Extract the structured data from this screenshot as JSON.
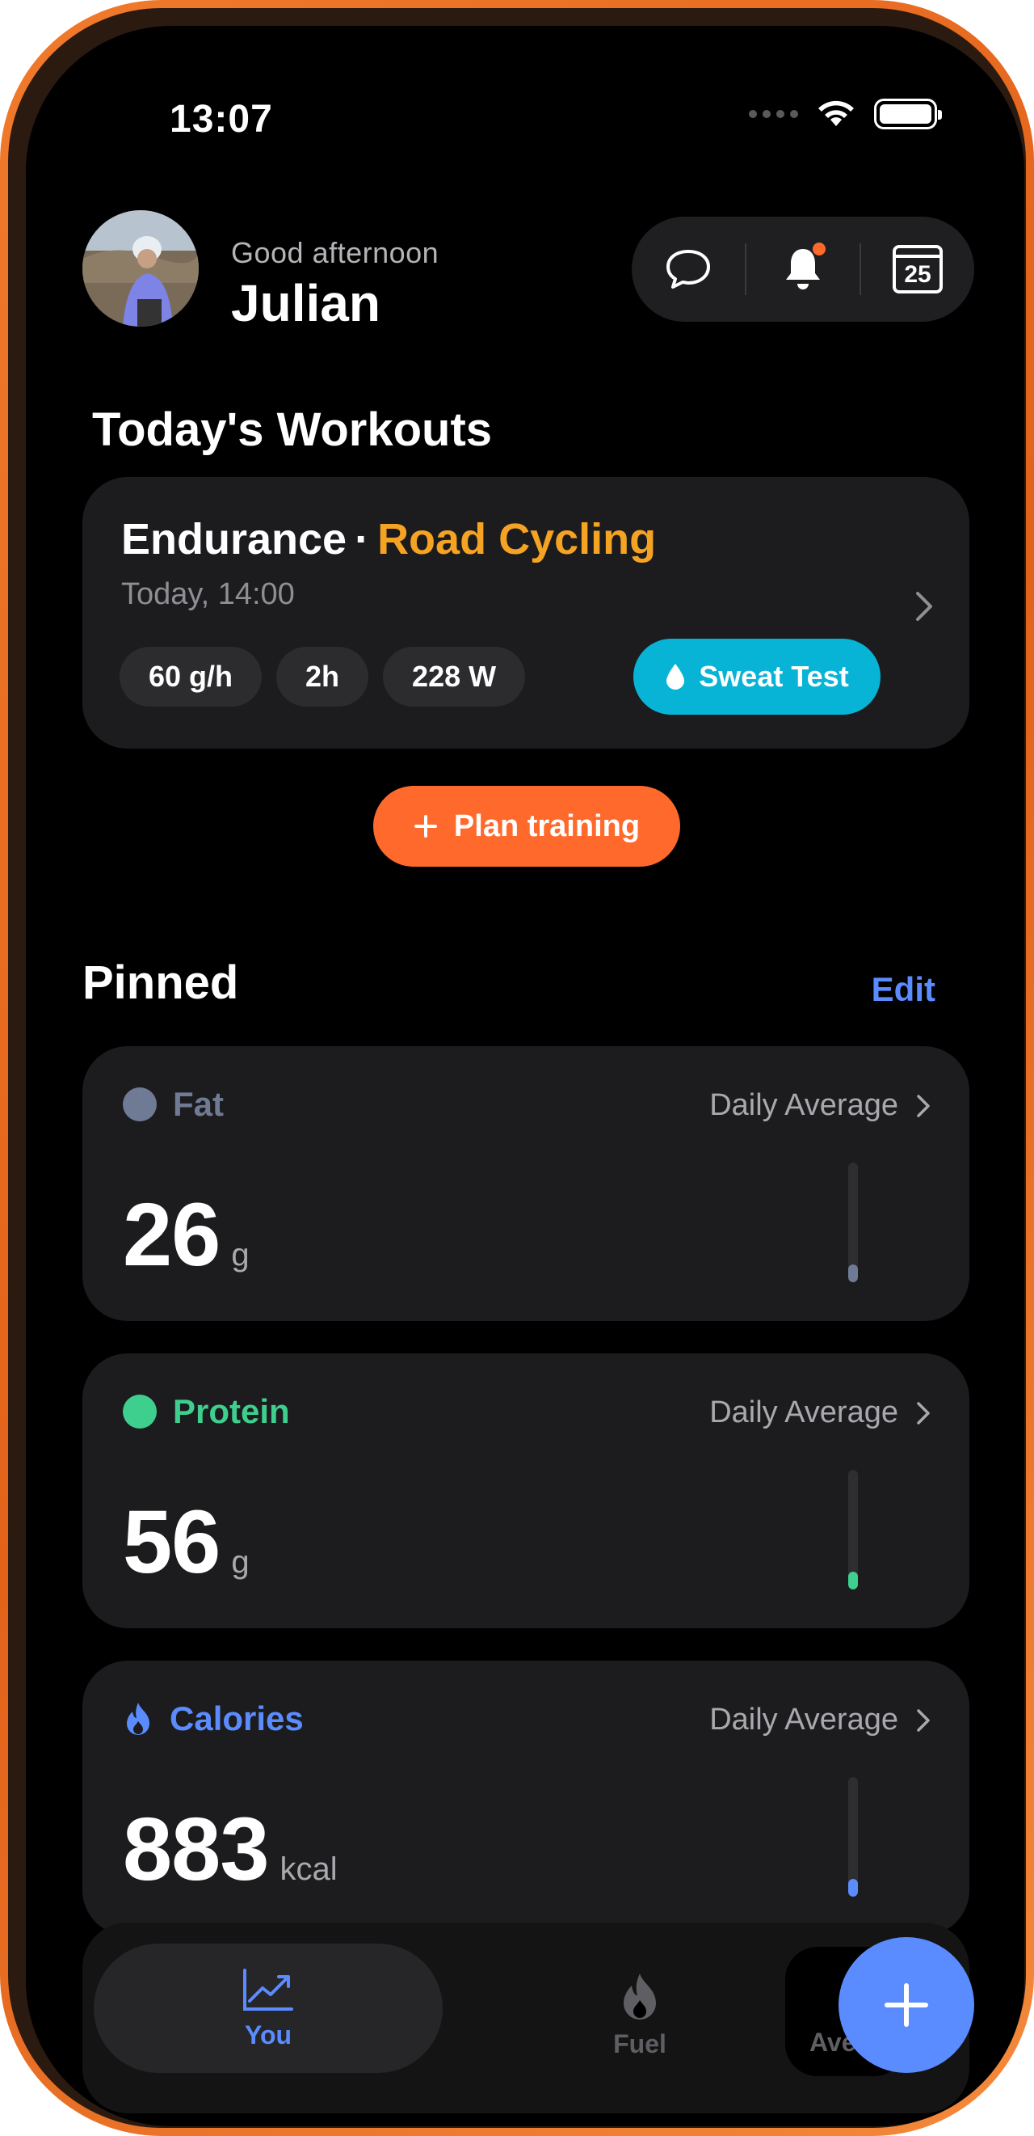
{
  "status_bar": {
    "time": "13:07"
  },
  "header": {
    "greeting": "Good afternoon",
    "name": "Julian",
    "calendar_day": "25"
  },
  "workouts": {
    "title": "Today's Workouts",
    "card": {
      "type": "Endurance",
      "separator": "·",
      "sport": "Road Cycling",
      "time": "Today, 14:00",
      "chips": [
        "60 g/h",
        "2h",
        "228 W"
      ],
      "sweat_label": "Sweat Test"
    },
    "plan_label": "Plan training"
  },
  "pinned": {
    "title": "Pinned",
    "edit_label": "Edit",
    "cards": [
      {
        "label": "Fat",
        "avg_label": "Daily Average",
        "value": "26",
        "unit": "g",
        "color": "#6f7b94",
        "level": 0.15
      },
      {
        "label": "Protein",
        "avg_label": "Daily Average",
        "value": "56",
        "unit": "g",
        "color": "#3ecf8e",
        "level": 0.15
      },
      {
        "label": "Calories",
        "avg_label": "Daily Average",
        "value": "883",
        "unit": "kcal",
        "color": "#5b8cff",
        "level": 0.15
      }
    ]
  },
  "tabbar": {
    "tabs": [
      {
        "label": "You",
        "icon": "chart-icon",
        "active": true
      },
      {
        "label": "Fuel",
        "icon": "flame-icon",
        "active": false
      },
      {
        "label": "Avera",
        "icon": "",
        "active": false
      }
    ],
    "fab_icon": "plus-icon"
  }
}
